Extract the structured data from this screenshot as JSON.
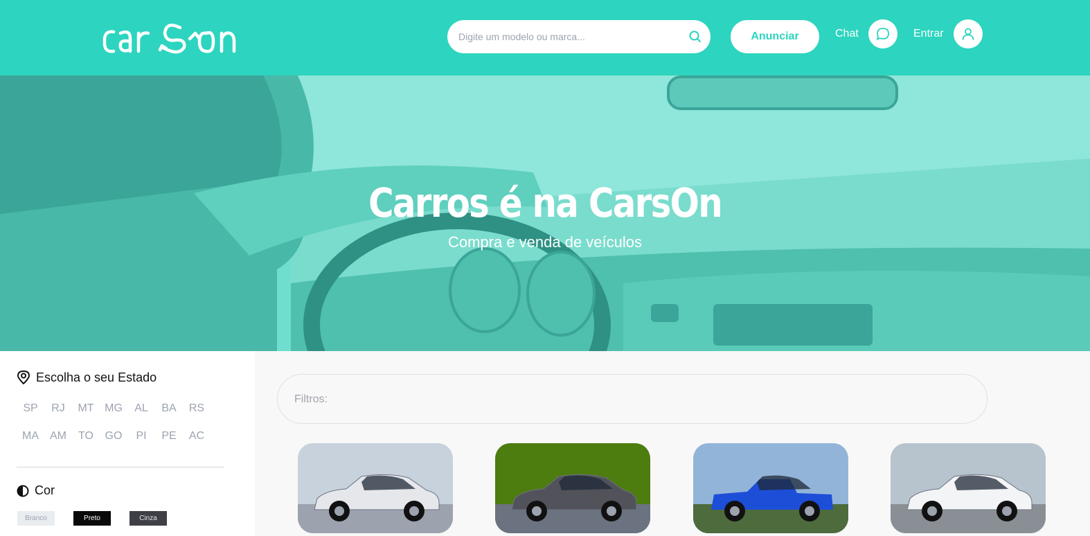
{
  "header": {
    "logo_text": "carSon",
    "search_placeholder": "Digite um modelo ou marca...",
    "anunciar_label": "Anunciar",
    "chat_label": "Chat",
    "login_label": "Entrar"
  },
  "hero": {
    "title": "Carros é na CarsOn",
    "subtitle": "Compra e venda de veículos"
  },
  "sidebar": {
    "state_heading": "Escolha o seu Estado",
    "states": [
      "SP",
      "RJ",
      "MT",
      "MG",
      "AL",
      "BA",
      "RS",
      "MA",
      "AM",
      "TO",
      "GO",
      "PI",
      "PE",
      "AC"
    ],
    "color_heading": "Cor",
    "colors": [
      {
        "label": "Branco",
        "bg": "#e9edf0",
        "fg": "#9ca3af"
      },
      {
        "label": "Preto",
        "bg": "#0a0a0a",
        "fg": "#ffffff"
      },
      {
        "label": "Cinza",
        "bg": "#3f3f46",
        "fg": "#e5e7eb"
      }
    ]
  },
  "main": {
    "filters_label": "Filtros:",
    "cars": [
      {
        "name": "white-hatchback",
        "body": "#e5e7eb",
        "sky": "#c7d2dc",
        "ground": "#9ca3af"
      },
      {
        "name": "gray-hatchback",
        "body": "#52525b",
        "sky": "#4d7c0f",
        "ground": "#6b7280"
      },
      {
        "name": "blue-pickup",
        "body": "#1d4ed8",
        "sky": "#93b4d9",
        "ground": "#4d6b3c"
      },
      {
        "name": "white-sedan",
        "body": "#f3f4f6",
        "sky": "#b7c3cd",
        "ground": "#8a8f96"
      }
    ]
  },
  "colors": {
    "accent": "#2dd4bf"
  }
}
